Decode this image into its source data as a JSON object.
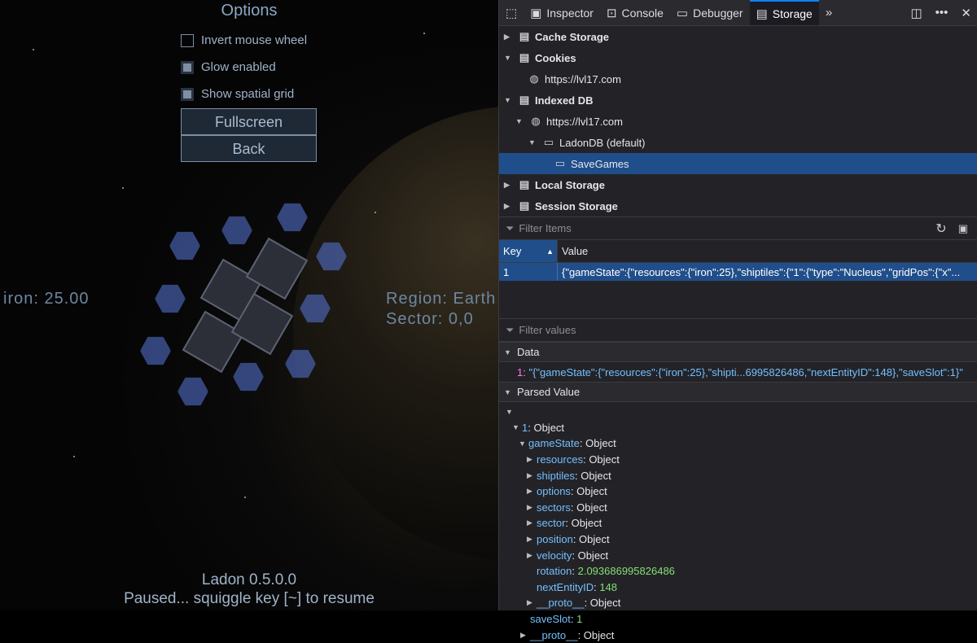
{
  "game": {
    "options_title": "Options",
    "options": [
      {
        "label": "Invert mouse wheel",
        "checked": false
      },
      {
        "label": "Glow enabled",
        "checked": true
      },
      {
        "label": "Show spatial grid",
        "checked": true
      }
    ],
    "buttons": {
      "fullscreen": "Fullscreen",
      "back": "Back"
    },
    "hud": {
      "resource": "iron: 25.00",
      "region": "Region: Earth",
      "sector": "Sector: 0,0"
    },
    "footer": {
      "version": "Ladon 0.5.0.0",
      "paused": "Paused... squiggle key [~] to resume"
    }
  },
  "devtools": {
    "tabs": [
      {
        "label": "Inspector",
        "icon": "inspector-icon"
      },
      {
        "label": "Console",
        "icon": "console-icon"
      },
      {
        "label": "Debugger",
        "icon": "debugger-icon"
      },
      {
        "label": "Storage",
        "icon": "storage-icon",
        "active": true
      }
    ],
    "tree": {
      "cache_storage": "Cache Storage",
      "cookies": "Cookies",
      "cookies_origin": "https://lvl17.com",
      "indexed_db": "Indexed DB",
      "idb_origin": "https://lvl17.com",
      "db_name": "LadonDB (default)",
      "store_name": "SaveGames",
      "local_storage": "Local Storage",
      "session_storage": "Session Storage"
    },
    "filter_items_placeholder": "Filter Items",
    "table": {
      "headers": {
        "key": "Key",
        "value": "Value"
      },
      "row": {
        "key": "1",
        "value": "{\"gameState\":{\"resources\":{\"iron\":25},\"shiptiles\":{\"1\":{\"type\":\"Nucleus\",\"gridPos\":{\"x\"..."
      }
    },
    "filter_values_placeholder": "Filter values",
    "data_section": {
      "title": "Data",
      "key": "1",
      "value": "\"{\"gameState\":{\"resources\":{\"iron\":25},\"shipti...6995826486,\"nextEntityID\":148},\"saveSlot\":1}\""
    },
    "parsed_section": {
      "title": "Parsed Value",
      "lines": [
        {
          "name": "1",
          "value": "Object"
        },
        {
          "name": "gameState",
          "value": "Object"
        },
        {
          "name": "resources",
          "value": "Object"
        },
        {
          "name": "shiptiles",
          "value": "Object"
        },
        {
          "name": "options",
          "value": "Object"
        },
        {
          "name": "sectors",
          "value": "Object"
        },
        {
          "name": "sector",
          "value": "Object"
        },
        {
          "name": "position",
          "value": "Object"
        },
        {
          "name": "velocity",
          "value": "Object"
        },
        {
          "name": "rotation",
          "value": "2.093686995826486"
        },
        {
          "name": "nextEntityID",
          "value": "148"
        },
        {
          "name": "__proto__",
          "value": "Object"
        },
        {
          "name": "saveSlot",
          "value": "1"
        },
        {
          "name": "__proto__",
          "value": "Object"
        }
      ]
    }
  }
}
